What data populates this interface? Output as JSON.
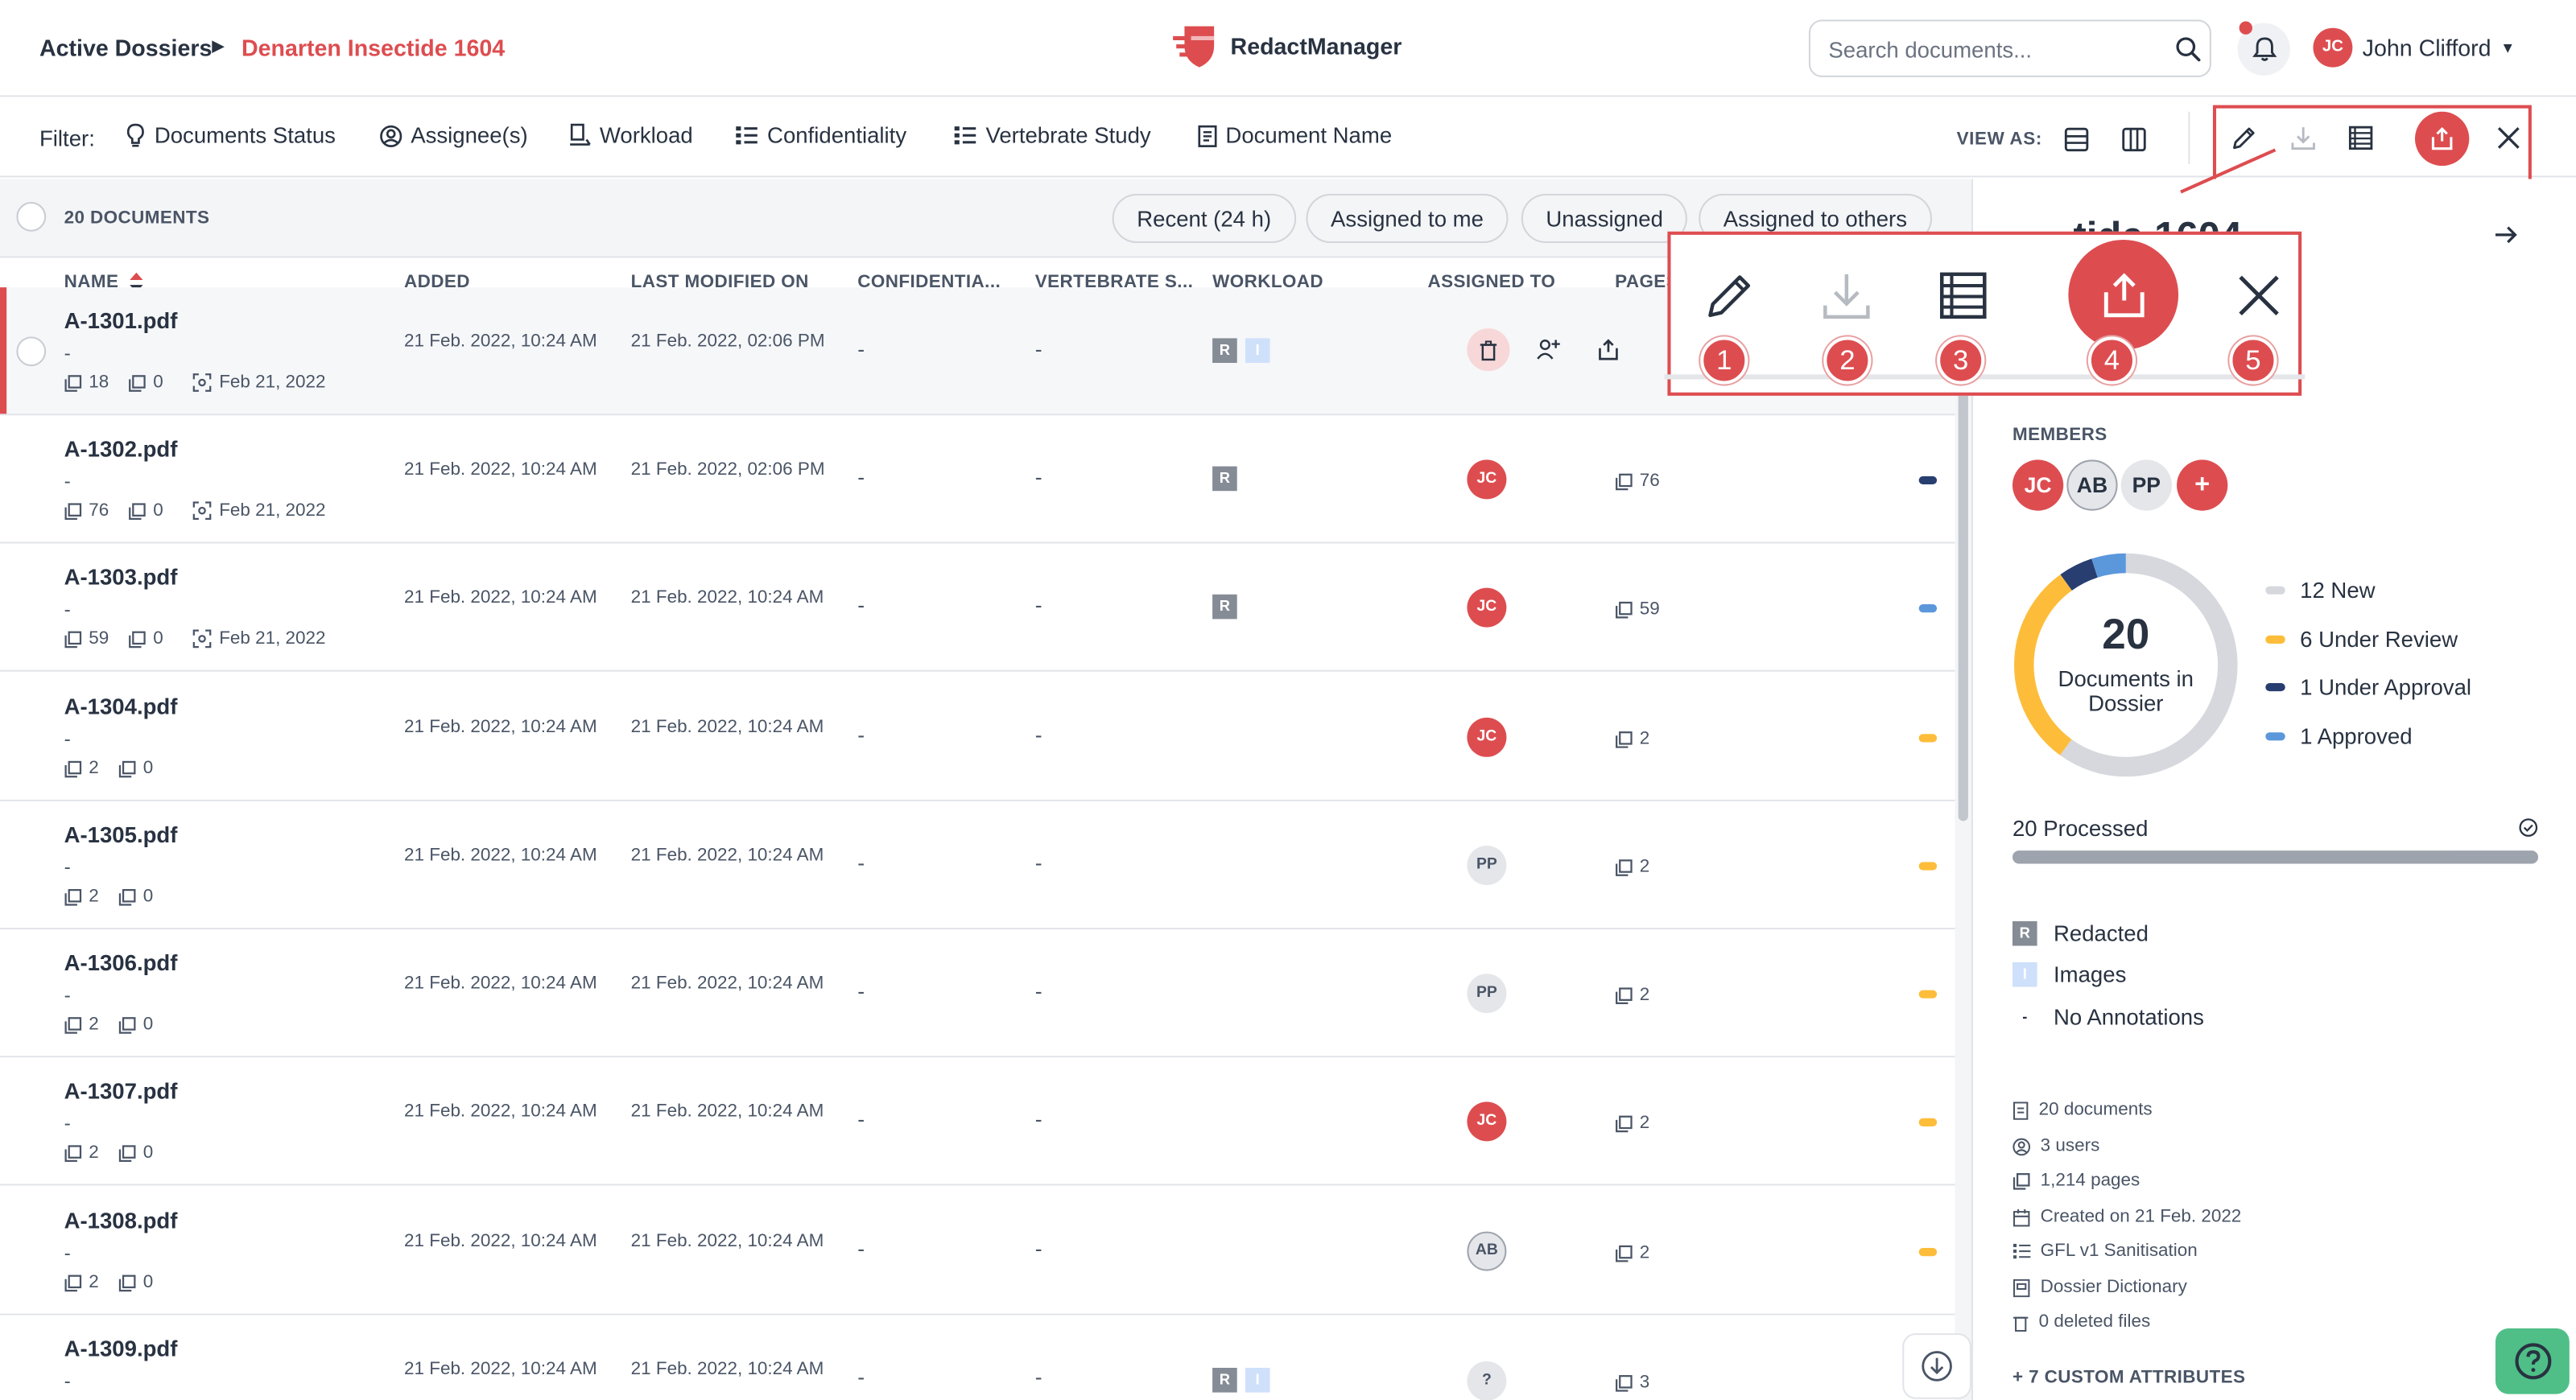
{
  "header": {
    "breadcrumb_root": "Active Dossiers",
    "breadcrumb_current": "Denarten Insectide 1604",
    "brand": "RedactManager",
    "search_placeholder": "Search documents...",
    "user_initials": "JC",
    "user_name": "John Clifford"
  },
  "filters": {
    "label": "Filter:",
    "items": [
      "Documents Status",
      "Assignee(s)",
      "Workload",
      "Confidentiality",
      "Vertebrate Study",
      "Document Name"
    ],
    "view_as": "VIEW AS:"
  },
  "list": {
    "count": "20 DOCUMENTS",
    "quick_filters": [
      "Recent (24 h)",
      "Assigned to me",
      "Unassigned",
      "Assigned to others"
    ],
    "columns": [
      "NAME",
      "ADDED",
      "LAST MODIFIED ON",
      "CONFIDENTIA...",
      "VERTEBRATE S...",
      "WORKLOAD",
      "ASSIGNED TO",
      "PAGES"
    ],
    "rows": [
      {
        "name": "A-1301.pdf",
        "dash": "-",
        "pages_meta": "18",
        "annot": "0",
        "ocr_date": "Feb 21, 2022",
        "added": "21 Feb. 2022, 10:24 AM",
        "modified": "21 Feb. 2022, 02:06 PM",
        "conf": "-",
        "vert": "-",
        "workload": [
          "R",
          "I"
        ],
        "assignee": "",
        "pages": "",
        "status_color": ""
      },
      {
        "name": "A-1302.pdf",
        "dash": "-",
        "pages_meta": "76",
        "annot": "0",
        "ocr_date": "Feb 21, 2022",
        "added": "21 Feb. 2022, 10:24 AM",
        "modified": "21 Feb. 2022, 02:06 PM",
        "conf": "-",
        "vert": "-",
        "workload": [
          "R"
        ],
        "assignee": "JC",
        "pages": "76",
        "status_color": "#283e70"
      },
      {
        "name": "A-1303.pdf",
        "dash": "-",
        "pages_meta": "59",
        "annot": "0",
        "ocr_date": "Feb 21, 2022",
        "added": "21 Feb. 2022, 10:24 AM",
        "modified": "21 Feb. 2022, 10:24 AM",
        "conf": "-",
        "vert": "-",
        "workload": [
          "R"
        ],
        "assignee": "JC",
        "pages": "59",
        "status_color": "#5b97db"
      },
      {
        "name": "A-1304.pdf",
        "dash": "-",
        "pages_meta": "2",
        "annot": "0",
        "ocr_date": "",
        "added": "21 Feb. 2022, 10:24 AM",
        "modified": "21 Feb. 2022, 10:24 AM",
        "conf": "-",
        "vert": "-",
        "workload": [],
        "assignee": "JC",
        "pages": "2",
        "status_color": "#fdbd3b"
      },
      {
        "name": "A-1305.pdf",
        "dash": "-",
        "pages_meta": "2",
        "annot": "0",
        "ocr_date": "",
        "added": "21 Feb. 2022, 10:24 AM",
        "modified": "21 Feb. 2022, 10:24 AM",
        "conf": "-",
        "vert": "-",
        "workload": [],
        "assignee": "PP",
        "pages": "2",
        "status_color": "#fdbd3b"
      },
      {
        "name": "A-1306.pdf",
        "dash": "-",
        "pages_meta": "2",
        "annot": "0",
        "ocr_date": "",
        "added": "21 Feb. 2022, 10:24 AM",
        "modified": "21 Feb. 2022, 10:24 AM",
        "conf": "-",
        "vert": "-",
        "workload": [],
        "assignee": "PP",
        "pages": "2",
        "status_color": "#fdbd3b"
      },
      {
        "name": "A-1307.pdf",
        "dash": "-",
        "pages_meta": "2",
        "annot": "0",
        "ocr_date": "",
        "added": "21 Feb. 2022, 10:24 AM",
        "modified": "21 Feb. 2022, 10:24 AM",
        "conf": "-",
        "vert": "-",
        "workload": [],
        "assignee": "JC",
        "pages": "2",
        "status_color": "#fdbd3b"
      },
      {
        "name": "A-1308.pdf",
        "dash": "-",
        "pages_meta": "2",
        "annot": "0",
        "ocr_date": "",
        "added": "21 Feb. 2022, 10:24 AM",
        "modified": "21 Feb. 2022, 10:24 AM",
        "conf": "-",
        "vert": "-",
        "workload": [],
        "assignee": "AB",
        "pages": "2",
        "status_color": "#fdbd3b"
      },
      {
        "name": "A-1309.pdf",
        "dash": "-",
        "pages_meta": "",
        "annot": "",
        "ocr_date": "",
        "added": "21 Feb. 2022, 10:24 AM",
        "modified": "21 Feb. 2022, 10:24 AM",
        "conf": "-",
        "vert": "-",
        "workload": [
          "R",
          "I"
        ],
        "assignee": "?",
        "pages": "3",
        "status_color": ""
      }
    ]
  },
  "details": {
    "title": "tide 1604",
    "members_label": "MEMBERS",
    "members": [
      "JC",
      "AB",
      "PP"
    ],
    "add_member": "+",
    "doc_total": "20",
    "doc_total_caption": "Documents in Dossier",
    "status_counts": {
      "new": 12,
      "under_review": 6,
      "under_approval": 1,
      "approved": 1
    },
    "legend": [
      "12 New",
      "6 Under Review",
      "1 Under Approval",
      "1 Approved"
    ],
    "legend_colors": [
      "#d6d8dd",
      "#fdbd3b",
      "#283e70",
      "#5b97db"
    ],
    "processed": "20 Processed",
    "processed_fraction": 1.0,
    "attributes": [
      "Redacted",
      "Images",
      "No Annotations"
    ],
    "attribute_badges": [
      "R",
      "I",
      "-"
    ],
    "info": [
      "20 documents",
      "3 users",
      "1,214 pages",
      "Created on 21 Feb. 2022",
      "GFL v1 Sanitisation",
      "Dossier Dictionary",
      "0 deleted files"
    ],
    "custom_attributes": "+ 7 CUSTOM ATTRIBUTES"
  },
  "callout": {
    "numbers": [
      "1",
      "2",
      "3",
      "4",
      "5"
    ]
  },
  "colors": {
    "accent": "#dd4d50",
    "text": "#283241",
    "muted": "#4a5566",
    "help": "#4fbf87"
  }
}
